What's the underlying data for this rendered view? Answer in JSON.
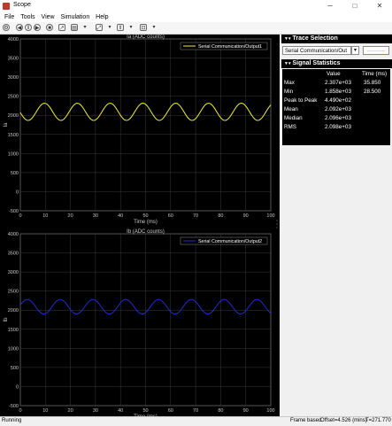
{
  "window": {
    "title": "Scope",
    "minimize": "─",
    "maximize": "□",
    "close": "✕"
  },
  "menu": [
    "File",
    "Tools",
    "View",
    "Simulation",
    "Help"
  ],
  "plots": [
    {
      "title": "Ia (ADC counts)",
      "ylabel": "Ia",
      "xlabel": "Time (ms)",
      "legend": "Serial Communication/Output1",
      "color": "#f5f020",
      "yticks": [
        "4000",
        "3500",
        "3000",
        "2500",
        "2000",
        "1500",
        "1000",
        "500",
        "0",
        "-500"
      ],
      "xticks": [
        "0",
        "10",
        "20",
        "30",
        "40",
        "50",
        "60",
        "70",
        "80",
        "90",
        "100"
      ]
    },
    {
      "title": "Ib (ADC counts)",
      "ylabel": "Ib",
      "xlabel": "Time (ms)",
      "legend": "Serial Communication/Output2",
      "color": "#1f2bd6",
      "yticks": [
        "4000",
        "3500",
        "3000",
        "2500",
        "2000",
        "1500",
        "1000",
        "500",
        "0",
        "-500"
      ],
      "xticks": [
        "0",
        "10",
        "20",
        "30",
        "40",
        "50",
        "60",
        "70",
        "80",
        "90",
        "100"
      ]
    }
  ],
  "chart_data": [
    {
      "type": "line",
      "title": "Ia (ADC counts)",
      "xlabel": "Time (ms)",
      "ylabel": "Ia",
      "xlim": [
        0,
        100
      ],
      "ylim": [
        -500,
        4000
      ],
      "grid": true,
      "legend_placement": "top-right",
      "series": [
        {
          "name": "Serial Communication/Output1",
          "mean": 2092,
          "amplitude": 225,
          "period_ms": 13.1,
          "phase_peak_ms": 35.85,
          "min": 1858,
          "max": 2307
        }
      ]
    },
    {
      "type": "line",
      "title": "Ib (ADC counts)",
      "xlabel": "Time (ms)",
      "ylabel": "Ib",
      "xlim": [
        0,
        100
      ],
      "ylim": [
        -500,
        4000
      ],
      "grid": true,
      "legend_placement": "top-right",
      "series": [
        {
          "name": "Serial Communication/Output2",
          "mean": 2090,
          "amplitude": 190,
          "period_ms": 13.1,
          "phase_peak_ms": 29.0,
          "min": 1900,
          "max": 2280
        }
      ]
    }
  ],
  "trace_selection": {
    "header": "Trace Selection",
    "selected": "Serial Communication/Out",
    "line_color": "#f5f020"
  },
  "signal_statistics": {
    "header": "Signal Statistics",
    "col_value": "Value",
    "col_time": "Time (ms)",
    "rows": [
      {
        "label": "Max",
        "value": "2.307e+03",
        "time": "35.850"
      },
      {
        "label": "Min",
        "value": "1.858e+03",
        "time": "28.500"
      },
      {
        "label": "Peak to Peak",
        "value": "4.490e+02",
        "time": ""
      },
      {
        "label": "Mean",
        "value": "2.092e+03",
        "time": ""
      },
      {
        "label": "Median",
        "value": "2.096e+03",
        "time": ""
      },
      {
        "label": "RMS",
        "value": "2.098e+03",
        "time": ""
      }
    ]
  },
  "status": {
    "state": "Running",
    "frame": "Frame based",
    "offset": "Offset=4.526 (mins)",
    "time": "T=271.770"
  }
}
